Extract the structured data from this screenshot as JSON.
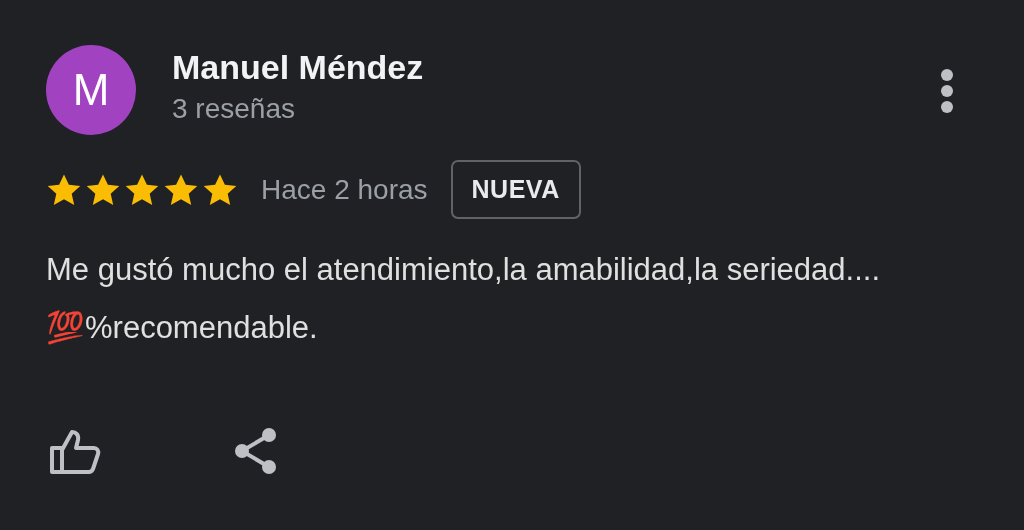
{
  "review": {
    "avatar_letter": "M",
    "author": "Manuel Méndez",
    "review_count": "3 reseñas",
    "stars": 5,
    "time": "Hace 2 horas",
    "badge": "NUEVA",
    "text": "Me gustó mucho el atendimiento,la amabilidad,la seriedad.... 💯%recomendable."
  }
}
